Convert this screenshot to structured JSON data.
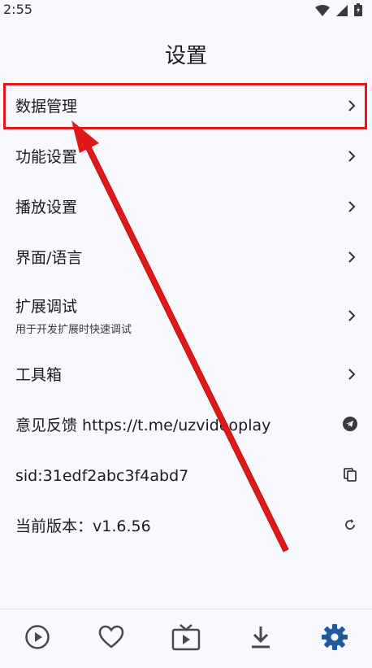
{
  "status_bar": {
    "time": "2:55"
  },
  "page": {
    "title": "设置"
  },
  "settings": {
    "items": [
      {
        "label": "数据管理",
        "trailing": "chevron-right-icon"
      },
      {
        "label": "功能设置",
        "trailing": "chevron-right-icon"
      },
      {
        "label": "播放设置",
        "trailing": "chevron-right-icon"
      },
      {
        "label": "界面/语言",
        "trailing": "chevron-right-icon"
      },
      {
        "label": "扩展调试",
        "sublabel": "用于开发扩展时快速调试",
        "trailing": "chevron-right-icon"
      },
      {
        "label": "工具箱",
        "trailing": "chevron-right-icon"
      },
      {
        "label": "意见反馈 https://t.me/uzvideoplay",
        "trailing": "telegram-icon"
      },
      {
        "label": "sid:31edf2abc3f4abd7",
        "trailing": "copy-icon"
      },
      {
        "label": "当前版本：v1.6.56",
        "trailing": "refresh-icon"
      }
    ]
  },
  "bottom_nav": {
    "items": [
      {
        "icon": "play-circle-icon",
        "active": false
      },
      {
        "icon": "heart-icon",
        "active": false
      },
      {
        "icon": "tv-icon",
        "active": false
      },
      {
        "icon": "download-icon",
        "active": false
      },
      {
        "icon": "settings-gear-icon",
        "active": true
      }
    ]
  },
  "colors": {
    "background": "#f8f9ff",
    "text": "#1b1b1f",
    "active_nav": "#1e5aa0",
    "annotation_red": "#e01818"
  }
}
